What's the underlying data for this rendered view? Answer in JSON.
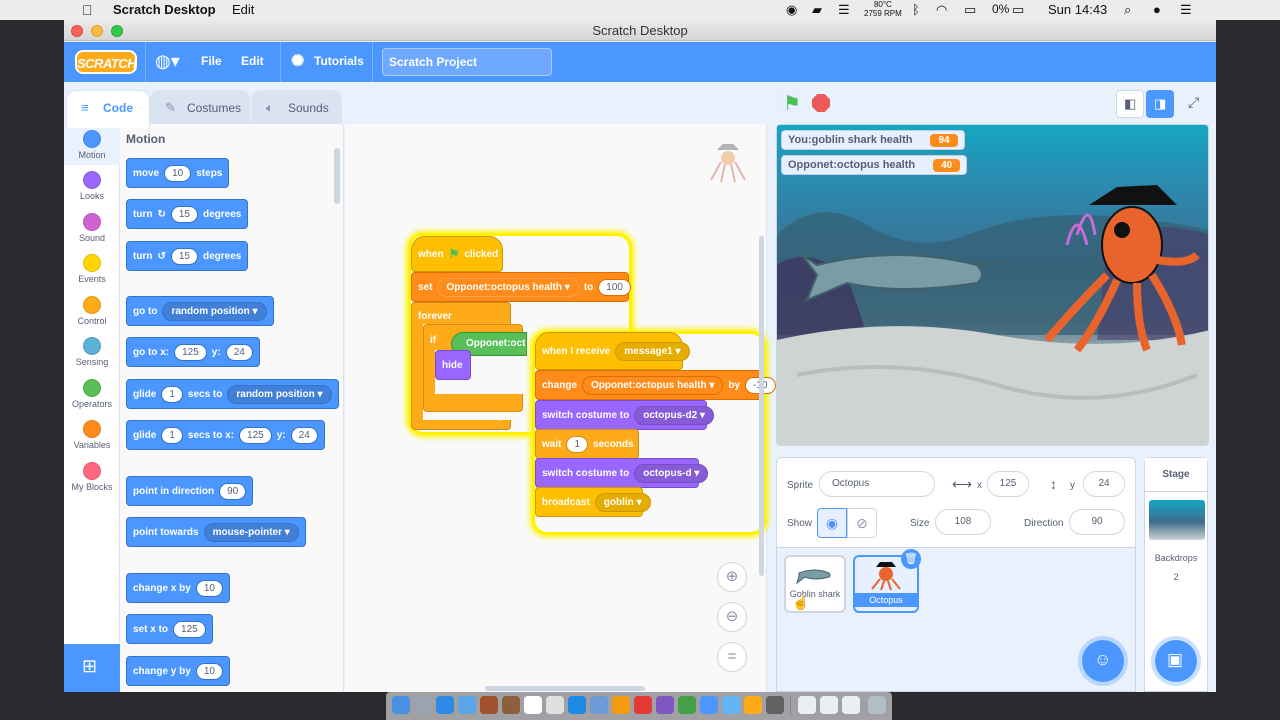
{
  "menubar": {
    "app_name": "Scratch Desktop",
    "menu_edit": "Edit",
    "temp": "80°C",
    "rpm": "2759 RPM",
    "battery": "0%",
    "clock": "Sun 14:43"
  },
  "window": {
    "title": "Scratch Desktop"
  },
  "toolbar": {
    "logo": "SCRATCH",
    "file": "File",
    "edit": "Edit",
    "tutorials": "Tutorials",
    "project_name": "Scratch Project"
  },
  "tabs": [
    {
      "label": "Code"
    },
    {
      "label": "Costumes"
    },
    {
      "label": "Sounds"
    }
  ],
  "categories": [
    {
      "label": "Motion",
      "color": "#4c97ff"
    },
    {
      "label": "Looks",
      "color": "#9966ff"
    },
    {
      "label": "Sound",
      "color": "#cf63cf"
    },
    {
      "label": "Events",
      "color": "#ffd500"
    },
    {
      "label": "Control",
      "color": "#ffab19"
    },
    {
      "label": "Sensing",
      "color": "#5cb1d6"
    },
    {
      "label": "Operators",
      "color": "#59c059"
    },
    {
      "label": "Variables",
      "color": "#ff8c1a"
    },
    {
      "label": "My Blocks",
      "color": "#ff6680"
    }
  ],
  "palette": {
    "heading": "Motion",
    "move": {
      "a": "move",
      "v": "10",
      "b": "steps"
    },
    "turn_right": {
      "a": "turn",
      "v": "15",
      "b": "degrees"
    },
    "turn_left": {
      "a": "turn",
      "v": "15",
      "b": "degrees"
    },
    "goto": {
      "a": "go to",
      "d": "random position"
    },
    "goto_xy": {
      "a": "go to x:",
      "x": "125",
      "b": "y:",
      "y": "24"
    },
    "glide_to": {
      "a": "glide",
      "v": "1",
      "b": "secs to",
      "d": "random position"
    },
    "glide_xy": {
      "a": "glide",
      "v": "1",
      "b": "secs to x:",
      "x": "125",
      "c": "y:",
      "y": "24"
    },
    "point_dir": {
      "a": "point in direction",
      "v": "90"
    },
    "point_towards": {
      "a": "point towards",
      "d": "mouse-pointer"
    },
    "change_x": {
      "a": "change x by",
      "v": "10"
    },
    "set_x": {
      "a": "set x to",
      "v": "125"
    },
    "change_y": {
      "a": "change y by",
      "v": "10"
    }
  },
  "script1": {
    "when": "when",
    "clicked": "clicked",
    "set": "set",
    "var": "Opponet:octopus health",
    "to": "to",
    "value": "100",
    "forever": "forever",
    "if": "if",
    "cond": "Opponet:oct",
    "hide": "hide"
  },
  "script2": {
    "when_receive": "when I receive",
    "message": "message1",
    "change": "change",
    "var": "Opponet:octopus health",
    "by": "by",
    "delta": "-10",
    "switch1": "switch costume to",
    "costume1": "octopus-d2",
    "wait": "wait",
    "wait_v": "1",
    "seconds": "seconds",
    "switch2": "switch costume to",
    "costume2": "octopus-d",
    "broadcast": "broadcast",
    "bmsg": "goblin"
  },
  "monitors": [
    {
      "label": "You:goblin shark health",
      "value": "94"
    },
    {
      "label": "Opponet:octopus health",
      "value": "40"
    }
  ],
  "sprite_info": {
    "sprite_label": "Sprite",
    "sprite_name": "Octopus",
    "x_label": "x",
    "x": "125",
    "y_label": "y",
    "y": "24",
    "show_label": "Show",
    "size_label": "Size",
    "size": "108",
    "direction_label": "Direction",
    "direction": "90"
  },
  "sprites": [
    {
      "name": "Goblin shark"
    },
    {
      "name": "Octopus"
    }
  ],
  "stage_pane": {
    "title": "Stage",
    "backdrops_label": "Backdrops",
    "backdrops_count": "2"
  }
}
